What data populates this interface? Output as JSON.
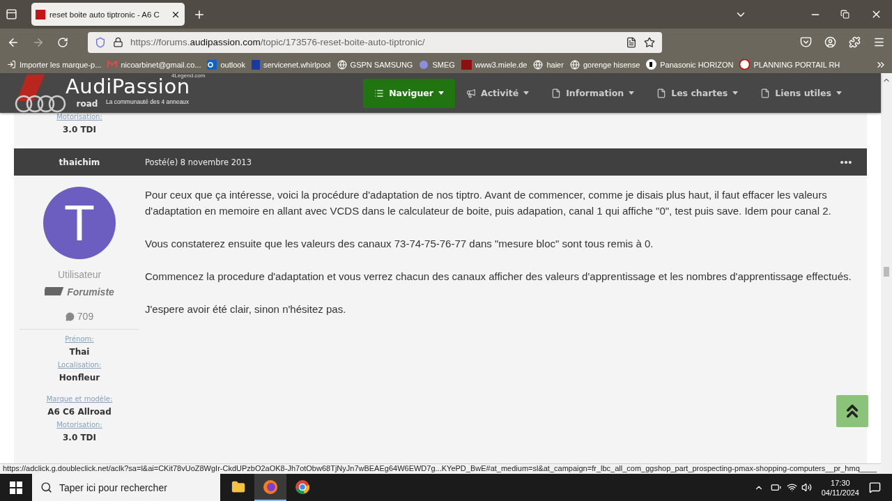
{
  "browser": {
    "tabs": [
      {
        "title": "reset boite auto tiptronic - A6 C",
        "selected": true
      }
    ],
    "url": {
      "prefix": "https://forums.",
      "domain": "audipassion.com",
      "path": "/topic/173576-reset-boite-auto-tiptronic/"
    },
    "bookmarks": [
      {
        "kind": "import",
        "label": "Importer les marque-p..."
      },
      {
        "kind": "gmail",
        "label": "nicoarbinet@gmail.co..."
      },
      {
        "kind": "outlook",
        "label": "outlook"
      },
      {
        "kind": "letter",
        "label": "servicenet.whirlpool"
      },
      {
        "kind": "globe",
        "label": "GSPN SAMSUNG"
      },
      {
        "kind": "smeg",
        "label": "SMEG"
      },
      {
        "kind": "miele",
        "label": "www3.miele.de"
      },
      {
        "kind": "globe",
        "label": "haier"
      },
      {
        "kind": "globe",
        "label": "gorenge hisense"
      },
      {
        "kind": "panasonic",
        "label": "Panasonic HORIZON"
      },
      {
        "kind": "planning",
        "label": "PLANNING PORTAIL RH"
      }
    ]
  },
  "site": {
    "logo": {
      "name": "AudiPassion",
      "tagline": "La communauté des 4 anneaux",
      "small": "4Legend.com"
    },
    "nav": [
      {
        "kind": "list",
        "label": "Naviguer",
        "selected": true
      },
      {
        "kind": "megaphone",
        "label": "Activité",
        "selected": false
      },
      {
        "kind": "doc",
        "label": "Information",
        "selected": false
      },
      {
        "kind": "doc",
        "label": "Les chartes",
        "selected": false
      },
      {
        "kind": "doc",
        "label": "Liens utiles",
        "selected": false
      }
    ]
  },
  "previous_post": {
    "fields": [
      {
        "value": "road"
      },
      {
        "label": "Motorisation:",
        "value": "3.0 TDI"
      }
    ]
  },
  "post": {
    "author": "thaichim",
    "date": "Posté(e) 8 novembre 2013",
    "avatar_letter": "T",
    "role": "Utilisateur",
    "rank": "Forumiste",
    "count": "709",
    "fields": [
      {
        "label": "Prénom:",
        "value": "Thai"
      },
      {
        "label": "Localisation:",
        "value": "Honfleur"
      },
      {
        "label": "Marque et modèle:",
        "value": "A6 C6 Allroad"
      },
      {
        "label": "Motorisation:",
        "value": "3.0 TDI"
      }
    ],
    "body": [
      "Pour ceux que ça intéresse, voici la procédure d'adaptation de nos tiptro. Avant de commencer, comme je disais plus haut, il faut effacer les valeurs d'adaptation en memoire en allant avec VCDS dans le calculateur de boite, puis adapation, canal 1 qui affiche \"0\", test puis save. Idem pour canal 2.",
      "Vous constaterez ensuite que les valeurs des canaux 73-74-75-76-77 dans \"mesure bloc\" sont tous remis à 0.",
      "Commencez la procedure d'adaptation et vous verrez chacun des canaux afficher des valeurs d'apprentissage et les nombres d'apprentissage effectués.",
      "J'espere avoir été clair, sinon n'hésitez pas."
    ]
  },
  "status_url": "https://adclick.g.doubleclick.net/aclk?sa=l&ai=CKit78vUoZ8WgIr-CkdUPzbO2aOK8-Jh7otObw68TjNyJn7wBEAEg64W6EWD7g...KYePD_BwE#at_medium=sl&at_campaign=fr_lbc_all_com_ggshop_part_prospecting-pmax-shopping-computers__pr_hmq____",
  "taskbar": {
    "search_placeholder": "Taper ici pour rechercher",
    "apps": [
      {
        "kind": "explorer",
        "selected": false
      },
      {
        "kind": "firefox",
        "selected": true
      },
      {
        "kind": "chrome",
        "selected": false
      }
    ],
    "time": "17:30",
    "date": "04/11/2024"
  }
}
